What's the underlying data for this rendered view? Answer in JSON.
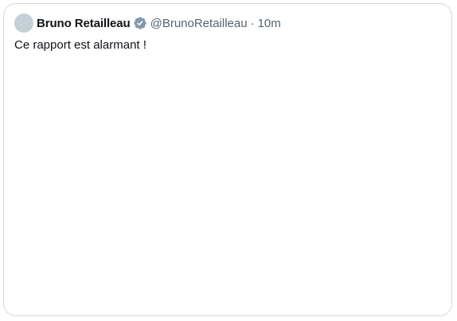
{
  "post": {
    "author_name": "Bruno Retailleau",
    "handle": "@BrunoRetailleau",
    "separator": "·",
    "time": "10m",
    "text": "Ce rapport est alarmant !",
    "verified_icon": "verified-badge-icon",
    "badge_color": "#829aab",
    "avatar_color": "#c4cfd6"
  }
}
